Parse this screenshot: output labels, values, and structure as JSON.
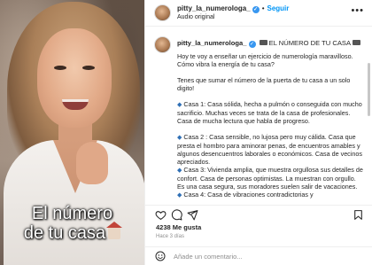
{
  "video": {
    "caption_line1": "El número",
    "caption_line2": "de tu casa",
    "caption_emoji": "house-emoji"
  },
  "post": {
    "header": {
      "username": "pitty_la_numerologa_",
      "separator": "•",
      "follow_label": "Seguir",
      "subtitle": "Audio original",
      "more_icon": "more-horizontal-icon"
    },
    "caption": {
      "username": "pitty_la_numerologa_",
      "title": "EL NÚMERO DE TU CASA",
      "paragraphs": [
        "Hoy te voy a enseñar un ejercicio de numerología maravilloso. Cómo vibra la energía de tu casa?",
        "Tenes que sumar el número de la puerta de tu casa a un solo digito!"
      ],
      "items": [
        "Casa 1: Casa sólida, hecha a pulmón o conseguida con mucho sacrificio. Muchas veces se trata de la casa de profesionales. Casa de mucha lectura que habla de progreso.",
        "Casa 2 : Casa sensible, no lujosa pero muy cálida. Casa que presta el hombro para aminorar penas, de encuentros amables y algunos desencuentros laborales o económicos. Casa de vecinos apreciados.",
        "Casa 3: Vivienda amplia, que muestra orgullosa sus detalles de confort. Casa de personas optimistas. La muestran con orgullo. Es una casa segura, sus moradores suelen salir de vacaciones.",
        "Casa 4: Casa de vibraciones contradictorias y"
      ]
    },
    "actions": {
      "like_icon": "heart-icon",
      "comment_icon": "comment-icon",
      "share_icon": "share-icon",
      "save_icon": "bookmark-icon"
    },
    "likes": "4238 Me gusta",
    "time_ago": "Hace 3 días",
    "comment_placeholder": "Añade un comentario..."
  }
}
